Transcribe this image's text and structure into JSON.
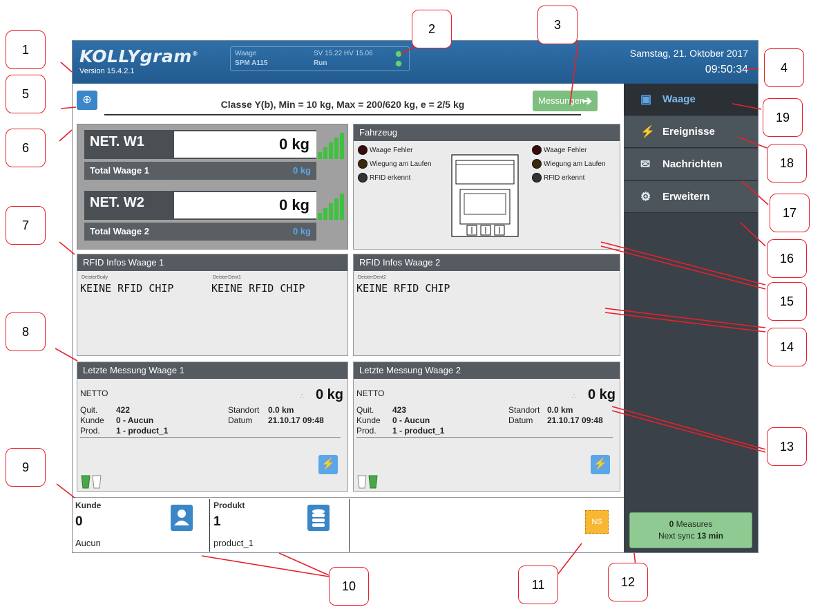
{
  "header": {
    "brand": "KOLLYgram",
    "brand_mark": "®",
    "version": "Version 15.4.2.1",
    "scale_name": "Waage",
    "scale_model": "SPM A115",
    "firmware": "SV 15.22  HV  15.06",
    "state": "Run",
    "date": "Samstag, 21. Oktober 2017",
    "time": "09:50:34"
  },
  "info": {
    "classe": "Classe Y(b), Min = 10 kg, Max = 200/620 kg, e = 2/5 kg",
    "measure_button": "Messungen"
  },
  "sidebar": {
    "items": [
      {
        "label": "Waage",
        "icon": "scale-icon",
        "active": true
      },
      {
        "label": "Ereignisse",
        "icon": "lightning-icon"
      },
      {
        "label": "Nachrichten",
        "icon": "envelope-icon"
      },
      {
        "label": "Erweitern",
        "icon": "gears-icon"
      }
    ],
    "sync": {
      "count": "0",
      "measures_label": "Measures",
      "next_label": "Next sync",
      "next_value": "13 min"
    }
  },
  "weights": {
    "w1": {
      "label": "NET. W1",
      "value": "0 kg",
      "total_label": "Total Waage 1",
      "total_value": "0 kg"
    },
    "w2": {
      "label": "NET. W2",
      "value": "0 kg",
      "total_label": "Total Waage 2",
      "total_value": "0 kg"
    }
  },
  "vehicle": {
    "title": "Fahrzeug",
    "status": [
      "Waage Fehler",
      "Wiegung am Laufen",
      "RFID erkennt"
    ],
    "status_colors": [
      "#3a0a0a",
      "#3a2a08",
      "#333333"
    ]
  },
  "rfid": {
    "p1_title": "RFID Infos Waage 1",
    "p1_tag1": "DeisterBody",
    "p1_val1": "KEINE RFID CHIP",
    "p1_tag2": "DeisterDent1",
    "p1_val2": "KEINE RFID CHIP",
    "p2_title": "RFID Infos Waage 2",
    "p2_tag1": "DeisterDent2",
    "p2_val1": "KEINE RFID CHIP"
  },
  "last": {
    "m1": {
      "title": "Letzte Messung Waage 1",
      "netto": "NETTO",
      "value": "0 kg",
      "quit_l": "Quit.",
      "quit": "422",
      "kunde_l": "Kunde",
      "kunde": "0 - Aucun",
      "prod_l": "Prod.",
      "prod": "1 - product_1",
      "standort_l": "Standort",
      "standort": "0.0 km",
      "datum_l": "Datum",
      "datum": "21.10.17 09:48"
    },
    "m2": {
      "title": "Letzte Messung Waage 2",
      "netto": "NETTO",
      "value": "0 kg",
      "quit_l": "Quit.",
      "quit": "423",
      "kunde_l": "Kunde",
      "kunde": "0 - Aucun",
      "prod_l": "Prod.",
      "prod": "1 - product_1",
      "standort_l": "Standort",
      "standort": "0.0 km",
      "datum_l": "Datum",
      "datum": "21.10.17 09:48"
    }
  },
  "bottom": {
    "kunde_label": "Kunde",
    "kunde_value": "0",
    "kunde_sub": "Aucun",
    "produkt_label": "Produkt",
    "produkt_value": "1",
    "produkt_sub": "product_1",
    "ns_label": "NS"
  },
  "callouts": [
    "1",
    "2",
    "3",
    "4",
    "5",
    "6",
    "7",
    "8",
    "9",
    "10",
    "11",
    "12",
    "13",
    "14",
    "15",
    "16",
    "17",
    "18",
    "19"
  ],
  "colors": {
    "accent": "#3b86c8",
    "header": "#2f6fa8",
    "callout": "#e8202a",
    "sync": "#8fca92",
    "ns": "#f7b733"
  }
}
